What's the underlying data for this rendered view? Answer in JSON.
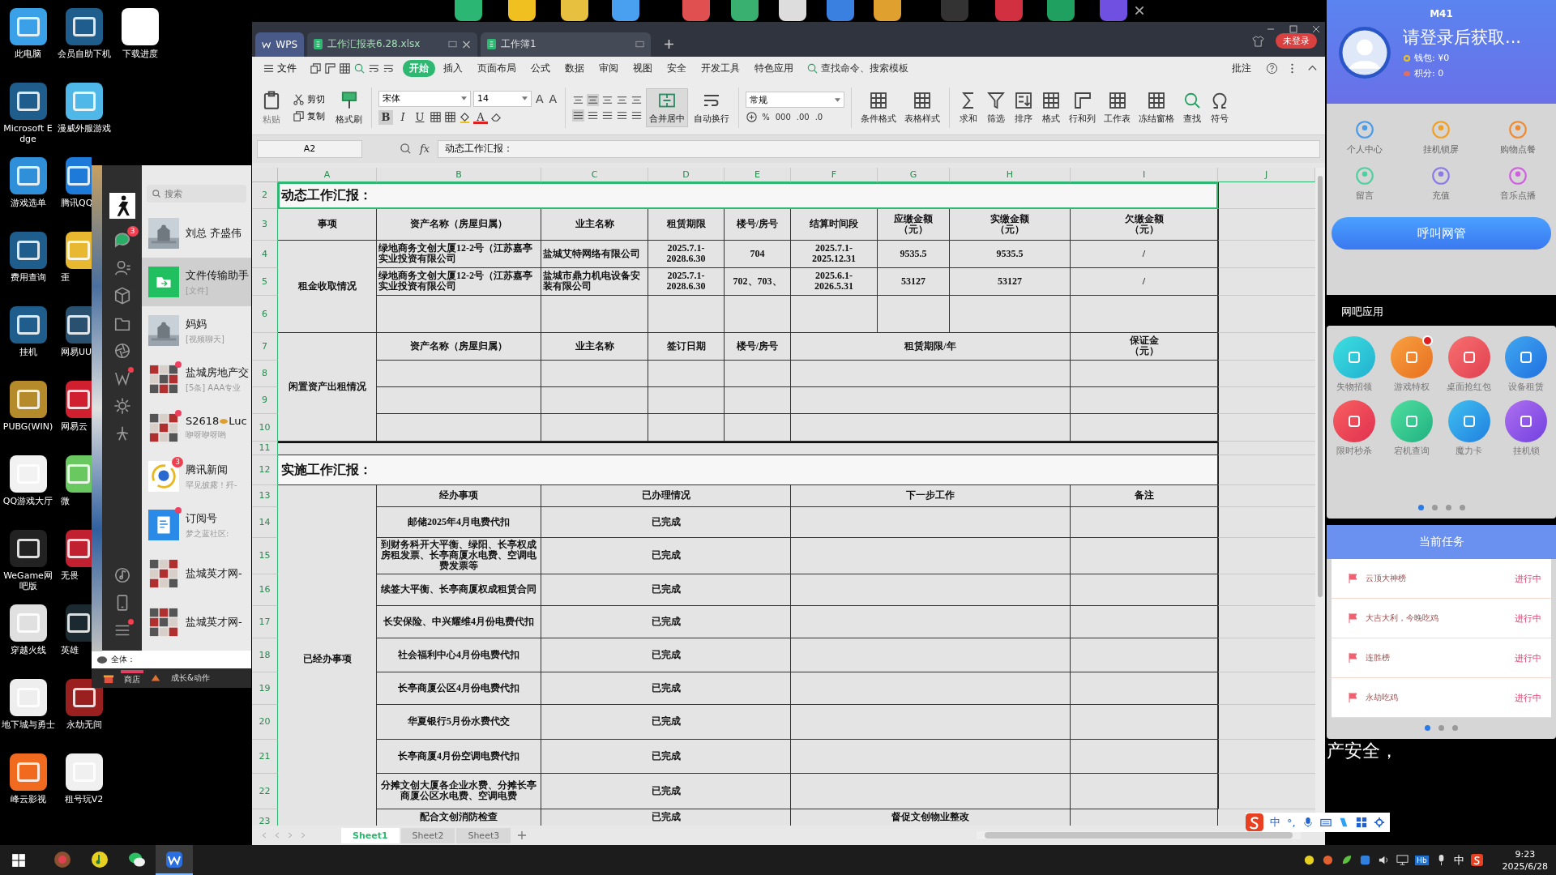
{
  "desktop": {
    "columns": [
      {
        "icons": [
          {
            "label": "此电脑",
            "kind": "full"
          },
          {
            "label": "Microsoft Edge",
            "kind": "full"
          },
          {
            "label": "游戏选单",
            "kind": "full"
          },
          {
            "label": "费用查询",
            "kind": "full"
          },
          {
            "label": "挂机",
            "kind": "full"
          },
          {
            "label": "PUBG(WIN)",
            "kind": "full"
          },
          {
            "label": "QQ游戏大厅",
            "kind": "full"
          },
          {
            "label": "WeGame网吧版",
            "kind": "full"
          },
          {
            "label": "穿越火线",
            "kind": "full"
          },
          {
            "label": "地下城与勇士",
            "kind": "full"
          },
          {
            "label": "峰云影视",
            "kind": "full"
          }
        ]
      },
      {
        "icons": [
          {
            "label": "会员自助下机",
            "kind": "full"
          },
          {
            "label": "漫威外服游戏",
            "kind": "full"
          },
          {
            "label": "腾讯QQ",
            "kind": "covered"
          },
          {
            "label": "歪",
            "kind": "covered"
          },
          {
            "label": "网易UU",
            "kind": "covered"
          },
          {
            "label": "网易云",
            "kind": "covered"
          },
          {
            "label": "微",
            "kind": "covered"
          },
          {
            "label": "无畏",
            "kind": "covered"
          },
          {
            "label": "英雄",
            "kind": "covered"
          },
          {
            "label": "永劫无间",
            "kind": "full"
          },
          {
            "label": "租号玩V2",
            "kind": "full"
          }
        ]
      },
      {
        "icons": [
          {
            "label": "下载进度",
            "kind": "full"
          }
        ]
      }
    ]
  },
  "wechat": {
    "search": {
      "placeholder": "搜索"
    },
    "sidebar": [
      {
        "dot": false
      },
      {
        "dot": false,
        "badge": "3"
      },
      {
        "dot": false
      },
      {
        "dot": false
      },
      {
        "dot": false
      },
      {
        "dot": false
      },
      {
        "dot": true
      },
      {
        "dot": false
      },
      {
        "dot": false
      },
      {
        "dot": false
      },
      {
        "dot": false
      },
      {
        "dot": true
      }
    ],
    "chats": [
      {
        "name": "刘总  齐盛伟",
        "selected": false,
        "unread": false
      },
      {
        "name": "文件传输助手",
        "preview": "[文件]",
        "kind": "folder",
        "selected": true,
        "unread": false
      },
      {
        "name": "妈妈",
        "preview": "[视频聊天]",
        "selected": false,
        "unread": false
      },
      {
        "name": "盐城房地产交",
        "preview": "[5条] AAA专业",
        "kind": "group",
        "selected": false,
        "unread": true
      },
      {
        "name": "S2618",
        "name_tail": "Luc",
        "preview": "咿呀咿呀哟",
        "kind": "group",
        "selected": false,
        "unread": true
      },
      {
        "name": "腾讯新闻",
        "preview": "罕见披露！歼-",
        "kind": "news",
        "selected": false,
        "unread": false,
        "badge": "3"
      },
      {
        "name": "订阅号",
        "preview": "梦之蓝社区:",
        "kind": "document",
        "selected": false,
        "unread": true
      },
      {
        "name": "盐城英才网-",
        "kind": "group",
        "selected": false,
        "unread": false
      },
      {
        "name": "盐城英才网-",
        "kind": "group",
        "selected": false,
        "unread": false
      }
    ],
    "game_bar": {
      "channel": "全体：",
      "tabs": [
        {
          "label": "商店",
          "selected": true
        },
        {
          "label": "成长&动作",
          "selected": false
        }
      ]
    }
  },
  "wps": {
    "tabs": [
      {
        "label": "WPS",
        "kind": "home",
        "selected": false
      },
      {
        "label": "工作汇报表6.28.xlsx",
        "kind": "file",
        "selected": true
      },
      {
        "label": "工作簿1",
        "kind": "file",
        "selected": false
      }
    ],
    "login": "未登录",
    "menu": {
      "file": "文件",
      "tabs": [
        {
          "label": "开始",
          "selected": true
        },
        {
          "label": "插入",
          "selected": false
        },
        {
          "label": "页面布局",
          "selected": false
        },
        {
          "label": "公式",
          "selected": false
        },
        {
          "label": "数据",
          "selected": false
        },
        {
          "label": "审阅",
          "selected": false
        },
        {
          "label": "视图",
          "selected": false
        },
        {
          "label": "安全",
          "selected": false
        },
        {
          "label": "开发工具",
          "selected": false
        },
        {
          "label": "特色应用",
          "selected": false
        }
      ],
      "search": "查找命令、搜索模板",
      "comment": "批注"
    },
    "ribbon": {
      "paste": {
        "label": "粘贴",
        "disabled": true
      },
      "cut": "剪切",
      "copy": "复制",
      "format_painter": "格式刷",
      "font": "宋体",
      "font_size": "14",
      "grow": "A",
      "shrink": "A",
      "styles": [
        {
          "label": "B",
          "selected": true
        },
        {
          "label": "I",
          "selected": false
        },
        {
          "label": "U",
          "selected": false
        }
      ],
      "font_color": "A",
      "merge": "合并居中",
      "wrap": "自动换行",
      "number_format": "常规",
      "number_buttons": [
        "%",
        "000",
        ".00",
        ".0"
      ],
      "tools": [
        "条件格式",
        "表格样式",
        "求和",
        "筛选",
        "排序",
        "格式",
        "行和列",
        "工作表",
        "冻结窗格",
        "查找",
        "符号"
      ]
    },
    "name_box": "A2",
    "fx": "fx",
    "formula": "动态工作汇报：",
    "sheet": {
      "columns": [
        "A",
        "B",
        "C",
        "D",
        "E",
        "F",
        "G",
        "H",
        "I",
        "J"
      ],
      "rows": [
        "2",
        "3",
        "4",
        "5",
        "6",
        "7",
        "8",
        "9",
        "10",
        "11",
        "12",
        "13",
        "14",
        "15",
        "16",
        "17",
        "18",
        "19",
        "20",
        "21",
        "22",
        "23"
      ],
      "report_1": {
        "title": "动态工作汇报：",
        "headers": [
          "事项",
          "资产名称（房屋归属）",
          "业主名称",
          "租赁期限",
          "楼号/房号",
          "结算时间段",
          "应缴金额（元）",
          "实缴金额（元）",
          "欠缴金额（元）"
        ],
        "rent_label": "租金收取情况",
        "rents": [
          [
            "绿地商务文创大厦12-2号（江苏嘉亭实业投资有限公司",
            "盐城艾特网络有限公司",
            "2025.7.1-\n2028.6.30",
            "704",
            "2025.7.1-\n2025.12.31",
            "9535.5",
            "9535.5",
            "/"
          ],
          [
            "绿地商务文创大厦12-2号（江苏嘉亭实业投资有限公司",
            "盐城市鼎力机电设备安装有限公司",
            "2025.7.1-\n2028.6.30",
            "702、703、",
            "2025.6.1-\n2026.5.31",
            "53127",
            "53127",
            "/"
          ]
        ],
        "idle_label": "闲置资产出租情况",
        "idle_headers": [
          "资产名称（房屋归属）",
          "业主名称",
          "签订日期",
          "楼号/房号",
          "租赁期限/年",
          "保证金（元）"
        ]
      },
      "report_2": {
        "title": "实施工作汇报：",
        "group_label": "已经办事项",
        "headers": [
          "经办事项",
          "已办理情况",
          "下一步工作",
          "备注"
        ],
        "tasks": [
          {
            "item": "邮储2025年4月电费代扣",
            "status": "已完成"
          },
          {
            "item": "到财务科开大平衡、绿阳、长亭权成房租发票、长亭商厦水电费、空调电费发票等",
            "status": "已完成"
          },
          {
            "item": "续签大平衡、长亭商厦权成租赁合同",
            "status": "已完成"
          },
          {
            "item": "长安保险、中兴耀维4月份电费代扣",
            "status": "已完成"
          },
          {
            "item": "社会福利中心4月份电费代扣",
            "status": "已完成"
          },
          {
            "item": "长亭商厦公区4月份电费代扣",
            "status": "已完成"
          },
          {
            "item": "华夏银行5月份水费代交",
            "status": "已完成"
          },
          {
            "item": "长亭商厦4月份空调电费代扣",
            "status": "已完成"
          },
          {
            "item": "分摊文创大厦各企业水费、分摊长亭商厦公区水电费、空调电费",
            "status": "已完成"
          },
          {
            "item": "配合文创消防检查",
            "status": "已完成",
            "next_step": "督促文创物业整改"
          }
        ]
      }
    },
    "sheet_tabs": [
      {
        "label": "Sheet1",
        "selected": true
      },
      {
        "label": "Sheet2",
        "selected": false
      },
      {
        "label": "Sheet3",
        "selected": false
      }
    ]
  },
  "side_panel": {
    "seat": "M41",
    "user": "请登录后获取...",
    "wallet": "钱包: ¥0",
    "points": "积分: 0",
    "shortcuts": [
      "个人中心",
      "挂机锁屏",
      "购物点餐",
      "留言",
      "充值",
      "音乐点播"
    ],
    "call_button": "呼叫网管",
    "apps_title": "网吧应用",
    "apps": [
      {
        "label": "失物招领",
        "dot": false
      },
      {
        "label": "游戏特权",
        "dot": true
      },
      {
        "label": "桌面抢红包",
        "dot": false
      },
      {
        "label": "设备租赁",
        "dot": false
      },
      {
        "label": "限时秒杀",
        "dot": false
      },
      {
        "label": "宕机查询",
        "dot": false
      },
      {
        "label": "魔力卡",
        "dot": false
      },
      {
        "label": "挂机锁",
        "dot": false
      }
    ],
    "apps_pages": [
      {
        "selected": true
      },
      {
        "selected": false
      },
      {
        "selected": false
      },
      {
        "selected": false
      }
    ],
    "tasks_title": "当前任务",
    "tasks": [
      {
        "name": "云顶大神榜",
        "status": "进行中"
      },
      {
        "name": "大吉大利，今晚吃鸡",
        "status": "进行中"
      },
      {
        "name": "连胜榜",
        "status": "进行中"
      },
      {
        "name": "永劫吃鸡",
        "status": "进行中"
      }
    ],
    "tasks_pages": [
      {
        "selected": true
      },
      {
        "selected": false
      },
      {
        "selected": false
      }
    ]
  },
  "background_text": "产安全，",
  "ime_bar": {
    "mode": "中",
    "punct": "°,"
  },
  "taskbar": {
    "apps": [
      {
        "selected": false
      },
      {
        "selected": false
      },
      {
        "selected": false
      },
      {
        "selected": true
      }
    ],
    "tray_badge": "Hb",
    "ime": "中",
    "time": "9:23",
    "date": "2025/6/28"
  }
}
